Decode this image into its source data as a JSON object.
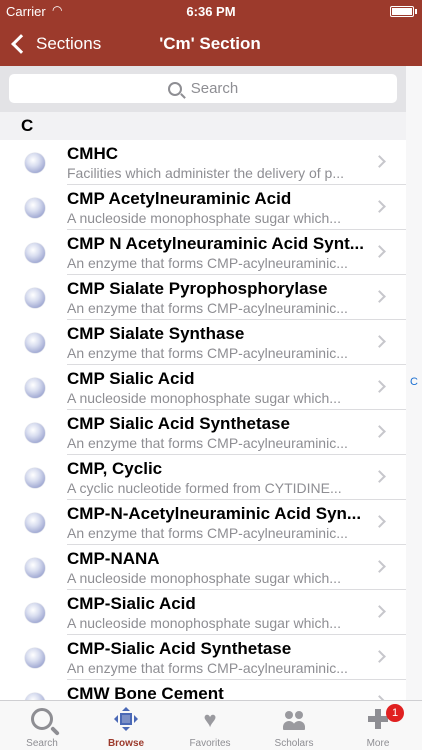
{
  "status_bar": {
    "carrier": "Carrier",
    "time": "6:36 PM"
  },
  "nav": {
    "back_label": "Sections",
    "title": "'Cm' Section"
  },
  "search": {
    "placeholder": "Search"
  },
  "section": {
    "letter": "C"
  },
  "index": {
    "letter": "C"
  },
  "rows": [
    {
      "title": "CMHC",
      "subtitle": "Facilities which administer the delivery of p..."
    },
    {
      "title": "CMP Acetylneuraminic Acid",
      "subtitle": "A nucleoside monophosphate sugar which..."
    },
    {
      "title": "CMP N Acetylneuraminic Acid Synt...",
      "subtitle": "An enzyme that forms CMP-acylneuraminic..."
    },
    {
      "title": "CMP Sialate Pyrophosphorylase",
      "subtitle": "An enzyme that forms CMP-acylneuraminic..."
    },
    {
      "title": "CMP Sialate Synthase",
      "subtitle": "An enzyme that forms CMP-acylneuraminic..."
    },
    {
      "title": "CMP Sialic Acid",
      "subtitle": "A nucleoside monophosphate sugar which..."
    },
    {
      "title": "CMP Sialic Acid Synthetase",
      "subtitle": "An enzyme that forms CMP-acylneuraminic..."
    },
    {
      "title": "CMP, Cyclic",
      "subtitle": "A cyclic nucleotide formed from CYTIDINE..."
    },
    {
      "title": "CMP-N-Acetylneuraminic Acid Syn...",
      "subtitle": "An enzyme that forms CMP-acylneuraminic..."
    },
    {
      "title": "CMP-NANA",
      "subtitle": "A nucleoside monophosphate sugar which..."
    },
    {
      "title": "CMP-Sialic Acid",
      "subtitle": "A nucleoside monophosphate sugar which..."
    },
    {
      "title": "CMP-Sialic Acid Synthetase",
      "subtitle": "An enzyme that forms CMP-acylneuraminic..."
    },
    {
      "title": "CMW Bone Cement",
      "subtitle": ""
    }
  ],
  "tabs": [
    {
      "label": "Search",
      "icon": "search-icon"
    },
    {
      "label": "Browse",
      "icon": "browse-icon",
      "active": true
    },
    {
      "label": "Favorites",
      "icon": "heart-icon"
    },
    {
      "label": "Scholars",
      "icon": "scholars-icon"
    },
    {
      "label": "More",
      "icon": "plus-icon",
      "badge": "1"
    }
  ],
  "colors": {
    "nav_bar": "#9c3a2c",
    "active_tab": "#9c3a2c",
    "badge": "#e02020"
  }
}
